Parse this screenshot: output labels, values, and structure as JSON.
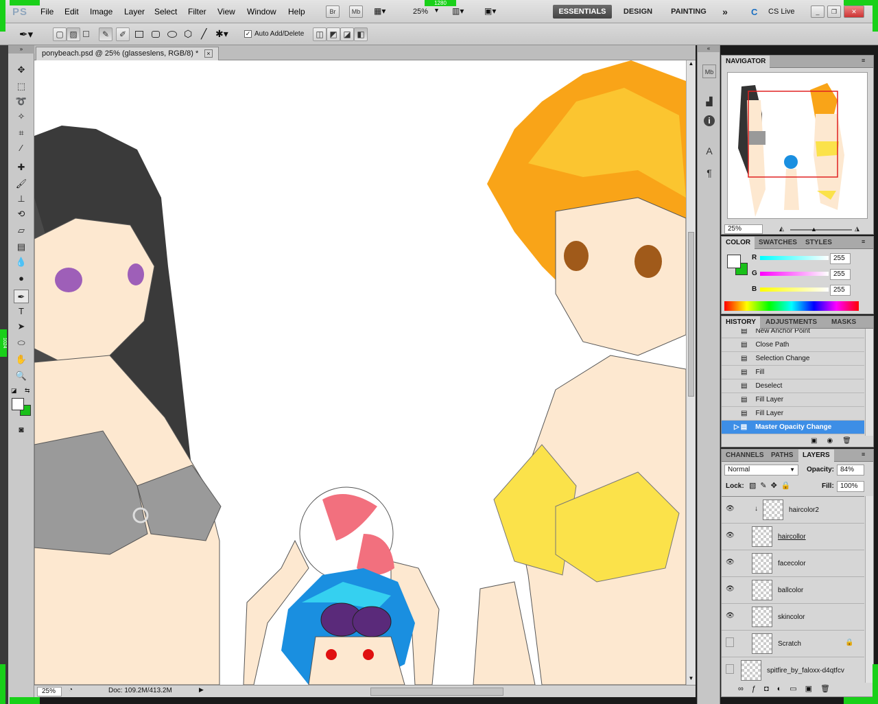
{
  "app": {
    "logo": "PS"
  },
  "menu": [
    "File",
    "Edit",
    "Image",
    "Layer",
    "Select",
    "Filter",
    "View",
    "Window",
    "Help"
  ],
  "appbar": {
    "bridge": "Br",
    "minibridge": "Mb",
    "zoom": "25%",
    "width_marker": "1280",
    "height_marker": "1024"
  },
  "workspaces": {
    "essentials": "ESSENTIALS",
    "design": "DESIGN",
    "painting": "PAINTING",
    "more": "»",
    "cslive": "CS Live"
  },
  "options": {
    "auto_add_delete": "Auto Add/Delete"
  },
  "document": {
    "tab_title": "ponybeach.psd @ 25% (glasseslens, RGB/8) *",
    "close": "×",
    "zoom": "25%",
    "doc_size": "Doc: 109.2M/413.2M"
  },
  "navigator": {
    "title": "NAVIGATOR",
    "zoom": "25%"
  },
  "color": {
    "tabs": [
      "COLOR",
      "SWATCHES",
      "STYLES"
    ],
    "r_label": "R",
    "g_label": "G",
    "b_label": "B",
    "r": "255",
    "g": "255",
    "b": "255",
    "fg": "#ffffff",
    "bg": "#19c019"
  },
  "history": {
    "tabs": [
      "HISTORY",
      "ADJUSTMENTS",
      "MASKS"
    ],
    "items": [
      "New Anchor Point",
      "Close Path",
      "Selection Change",
      "Fill",
      "Deselect",
      "Fill Layer",
      "Fill Layer",
      "Master Opacity Change"
    ]
  },
  "layers": {
    "tabs": [
      "CHANNELS",
      "PATHS",
      "LAYERS"
    ],
    "blend": "Normal",
    "opacity_label": "Opacity:",
    "opacity": "84%",
    "lock_label": "Lock:",
    "fill_label": "Fill:",
    "fill": "100%",
    "items": [
      "haircolor2",
      "haircollor",
      "facecolor",
      "ballcolor",
      "skincolor",
      "Scratch",
      "spitfire_by_faloxx-d4qtfcv"
    ]
  }
}
